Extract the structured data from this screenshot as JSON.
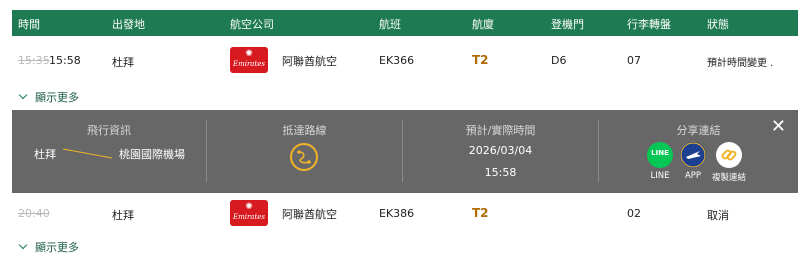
{
  "header": {
    "time": "時間",
    "origin": "出發地",
    "airline": "航空公司",
    "flight": "航班",
    "terminal": "航廈",
    "gate": "登機門",
    "baggage": "行李轉盤",
    "status": "狀態"
  },
  "flights": [
    {
      "scheduled_time": "15:35",
      "actual_time": "15:58",
      "origin": "杜拜",
      "airline_logo_text": "Emirates",
      "airline": "阿聯酋航空",
      "flight": "EK366",
      "terminal": "T2",
      "gate": "D6",
      "baggage": "07",
      "status": "預計時間變更 ."
    },
    {
      "scheduled_time": "20:40",
      "actual_time": "",
      "origin": "杜拜",
      "airline_logo_text": "Emirates",
      "airline": "阿聯酋航空",
      "flight": "EK386",
      "terminal": "T2",
      "gate": "",
      "baggage": "02",
      "status": "取消"
    }
  ],
  "show_more_label": "顯示更多",
  "detail": {
    "flight_info_title": "飛行資訊",
    "from": "杜拜",
    "to": "桃園國際機場",
    "route_title": "抵達路線",
    "time_title": "預計/實際時間",
    "date": "2026/03/04",
    "time": "15:58",
    "share_title": "分享連結",
    "share": {
      "line_icon_text": "LINE",
      "line_label": "LINE",
      "app_label": "APP",
      "copy_label": "複製連結"
    },
    "close_glyph": "✕"
  },
  "colors": {
    "header_bg": "#1e7a53",
    "panel_bg": "#676767",
    "emirates_red": "#d71920",
    "terminal_text": "#b26b00",
    "route_icon": "#f0b429",
    "line_green": "#06c755"
  },
  "icons": [
    "emirates-logo",
    "chevron-down-icon",
    "route-icon",
    "line-icon",
    "app-icon",
    "link-icon",
    "close-icon"
  ]
}
